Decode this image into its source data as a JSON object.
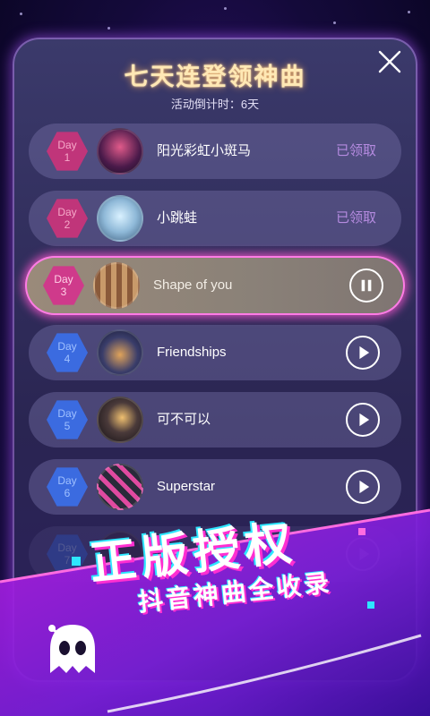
{
  "title": "七天连登领神曲",
  "countdown": "活动倒计时：6天",
  "claimed_label": "已领取",
  "days": [
    {
      "day_word": "Day",
      "day_num": "1",
      "song": "阳光彩虹小斑马",
      "state": "claimed",
      "action": "claimed"
    },
    {
      "day_word": "Day",
      "day_num": "2",
      "song": "小跳蛙",
      "state": "claimed",
      "action": "claimed"
    },
    {
      "day_word": "Day",
      "day_num": "3",
      "song": "Shape of you",
      "state": "current",
      "action": "pause"
    },
    {
      "day_word": "Day",
      "day_num": "4",
      "song": "Friendships",
      "state": "locked",
      "action": "play"
    },
    {
      "day_word": "Day",
      "day_num": "5",
      "song": "可不可以",
      "state": "locked",
      "action": "play"
    },
    {
      "day_word": "Day",
      "day_num": "6",
      "song": "Superstar",
      "state": "locked",
      "action": "play"
    },
    {
      "day_word": "Day",
      "day_num": "7",
      "song": "",
      "state": "locked",
      "action": "play"
    }
  ],
  "banner": {
    "main": "正版授权",
    "sub": "抖音神曲全收录"
  },
  "icons": {
    "close": "close-icon",
    "play": "play-icon",
    "pause": "pause-icon",
    "mascot": "ghost-mascot-icon"
  },
  "colors": {
    "accent_pink": "#ff5fd6",
    "hex_claimed": "#c0357a",
    "hex_locked": "#3b6be0",
    "claimed_text": "#b58be0",
    "title_glow": "#ffe8b5"
  }
}
